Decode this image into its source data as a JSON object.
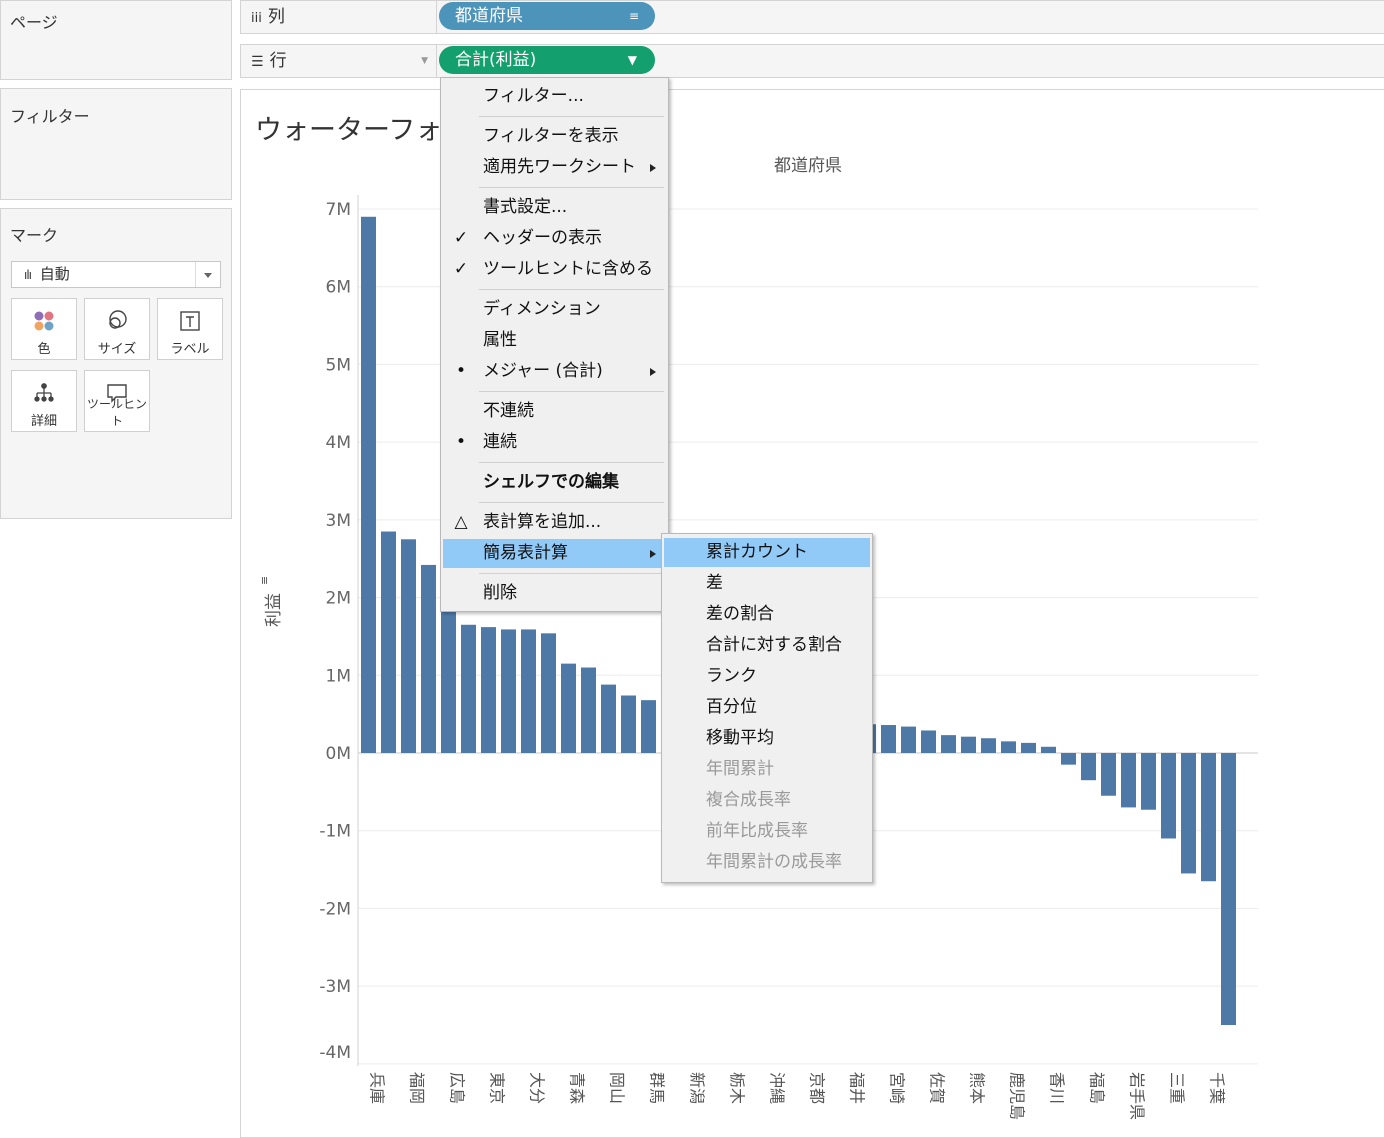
{
  "left_panel": {
    "pages_title": "ページ",
    "filters_title": "フィルター",
    "marks_title": "マーク",
    "mark_type": "自動",
    "mark_buttons": [
      {
        "label": "色",
        "icon": "color-dots-icon"
      },
      {
        "label": "サイズ",
        "icon": "size-circles-icon"
      },
      {
        "label": "ラベル",
        "icon": "label-t-icon"
      },
      {
        "label": "詳細",
        "icon": "detail-tree-icon"
      },
      {
        "label": "ツールヒント",
        "icon": "tooltip-bubble-icon"
      }
    ]
  },
  "shelves": {
    "columns": {
      "label": "列",
      "pill": "都道府県",
      "pill_color": "#4c94b9"
    },
    "rows": {
      "label": "行",
      "pill": "合計(利益)",
      "pill_color": "#13a06e"
    }
  },
  "view": {
    "title": "ウォーターフォール"
  },
  "chart_data": {
    "type": "bar",
    "title": "ウォーターフォール",
    "xlabel": "都道府県",
    "ylabel": "利益",
    "ylim": [
      -4000000,
      7000000
    ],
    "yticks": [
      "7M",
      "6M",
      "5M",
      "4M",
      "3M",
      "2M",
      "1M",
      "0M",
      "-1M",
      "-2M",
      "-3M",
      "-4M"
    ],
    "ytick_values": [
      7000000,
      6000000,
      5000000,
      4000000,
      3000000,
      2000000,
      1000000,
      0,
      -1000000,
      -2000000,
      -3000000,
      -4000000
    ],
    "categories": [
      "兵庫",
      "",
      "福岡",
      "",
      "広島",
      "",
      "東京",
      "",
      "大分",
      "",
      "青森",
      "",
      "岡山",
      "",
      "群馬",
      "",
      "新潟",
      "",
      "栃木",
      "",
      "沖縄",
      "",
      "京都",
      "",
      "福井",
      "",
      "宮崎",
      "",
      "佐賀",
      "",
      "熊本",
      "",
      "鹿児島",
      "",
      "香川",
      "",
      "福島",
      "",
      "岩手県",
      "",
      "三重",
      "",
      "千葉",
      ""
    ],
    "values": [
      6900000,
      2850000,
      2750000,
      2420000,
      2050000,
      1650000,
      1620000,
      1590000,
      1590000,
      1540000,
      1150000,
      1100000,
      880000,
      740000,
      680000,
      600000,
      520000,
      480000,
      460000,
      430000,
      410000,
      390000,
      380000,
      370000,
      380000,
      370000,
      360000,
      340000,
      290000,
      230000,
      210000,
      190000,
      150000,
      130000,
      80000,
      -150000,
      -350000,
      -550000,
      -700000,
      -730000,
      -1100000,
      -1550000,
      -1650000,
      -3500000
    ],
    "bar_color": "#4e79a7",
    "grid": true
  },
  "context_menu": {
    "items": [
      {
        "label": "フィルター...",
        "mark": ""
      },
      {
        "sep": true
      },
      {
        "label": "フィルターを表示",
        "mark": ""
      },
      {
        "label": "適用先ワークシート",
        "mark": "",
        "submenu": true
      },
      {
        "sep": true
      },
      {
        "label": "書式設定...",
        "mark": ""
      },
      {
        "label": "ヘッダーの表示",
        "mark": "✓"
      },
      {
        "label": "ツールヒントに含める",
        "mark": "✓"
      },
      {
        "sep": true
      },
      {
        "label": "ディメンション",
        "mark": ""
      },
      {
        "label": "属性",
        "mark": ""
      },
      {
        "label": "メジャー (合計)",
        "mark": "•",
        "submenu": true
      },
      {
        "sep": true
      },
      {
        "label": "不連続",
        "mark": ""
      },
      {
        "label": "連続",
        "mark": "•"
      },
      {
        "sep": true
      },
      {
        "label": "シェルフでの編集",
        "mark": "",
        "bold": true
      },
      {
        "sep": true
      },
      {
        "label": "表計算を追加...",
        "mark": "△"
      },
      {
        "label": "簡易表計算",
        "mark": "",
        "submenu": true,
        "highlight": true
      },
      {
        "sep": true
      },
      {
        "label": "削除",
        "mark": ""
      }
    ]
  },
  "submenu": {
    "items": [
      {
        "label": "累計カウント",
        "highlight": true
      },
      {
        "label": "差"
      },
      {
        "label": "差の割合"
      },
      {
        "label": "合計に対する割合"
      },
      {
        "label": "ランク"
      },
      {
        "label": "百分位"
      },
      {
        "label": "移動平均"
      },
      {
        "label": "年間累計",
        "disabled": true
      },
      {
        "label": "複合成長率",
        "disabled": true
      },
      {
        "label": "前年比成長率",
        "disabled": true
      },
      {
        "label": "年間累計の成長率",
        "disabled": true
      }
    ]
  }
}
